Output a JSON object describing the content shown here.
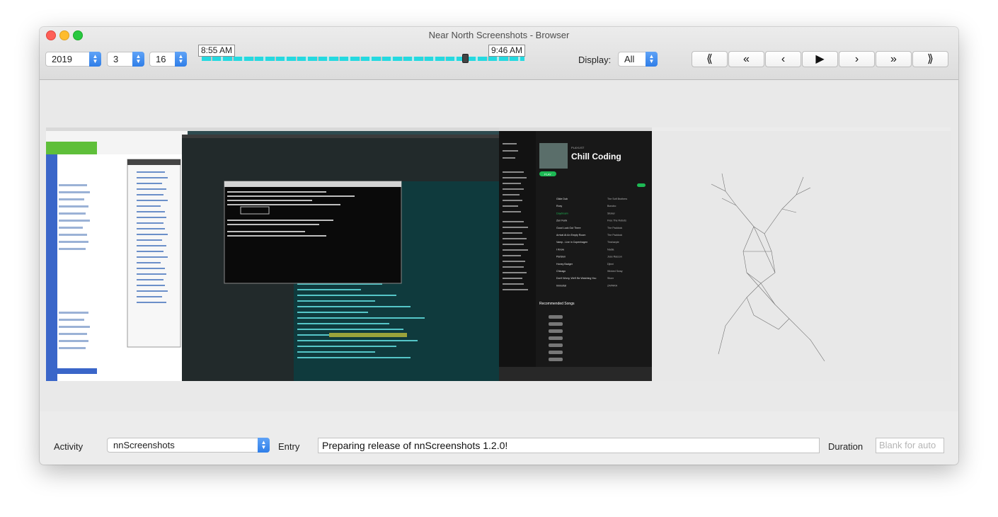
{
  "window": {
    "title": "Near North Screenshots - Browser"
  },
  "toolbar": {
    "year": "2019",
    "month": "3",
    "day": "16",
    "start_time": "8:55 AM",
    "end_time": "9:46 AM",
    "display_label": "Display:",
    "display_value": "All",
    "nav_buttons": [
      {
        "symbol": "⟪",
        "name": "first-icon"
      },
      {
        "symbol": "«",
        "name": "previous-group-icon"
      },
      {
        "symbol": "‹",
        "name": "previous-icon"
      },
      {
        "symbol": "▶",
        "name": "play-icon"
      },
      {
        "symbol": "›",
        "name": "next-icon"
      },
      {
        "symbol": "»",
        "name": "next-group-icon"
      },
      {
        "symbol": "⟫",
        "name": "last-icon"
      }
    ]
  },
  "screenshot": {
    "terminal_prompt": "$ ssh -p 22 nnscreenshots.release",
    "spotify_playlist_label": "PLAYLIST",
    "spotify_playlist_title": "Chill Coding",
    "spotify_play_button": "PLAY",
    "spotify_recommended": "Recommended Songs",
    "spotify_tracks": [
      "Glide Dub",
      "Roxy",
      "Daydream",
      "Zen Funk",
      "Good Luck Out There",
      "Arrival At An Empty Room",
      "Vamp - Live in Copenhagen",
      "I Know",
      "Parisien",
      "Honey Badger",
      "Chicago",
      "Don't Worry, We'll Be Watching You",
      "Immortal"
    ],
    "spotify_artists": [
      "The Soft Brothers",
      "Bonobo",
      "Slicker",
      "Free The Robots",
      "The Paddock",
      "The Paddock",
      "Tinsharpie",
      "Nadia",
      "Jose Rascon",
      "Djinni",
      "Wicked Sway",
      "Slicer",
      "ZAPARA"
    ]
  },
  "footer": {
    "activity_label": "Activity",
    "activity_value": "nnScreenshots",
    "entry_label": "Entry",
    "entry_value": "Preparing release of nnScreenshots 1.2.0!",
    "duration_label": "Duration",
    "duration_placeholder": "Blank for auto"
  },
  "colors": {
    "timeline": "#25d9e0",
    "accent": "#2f7ee8",
    "spotify_green": "#1db954"
  }
}
